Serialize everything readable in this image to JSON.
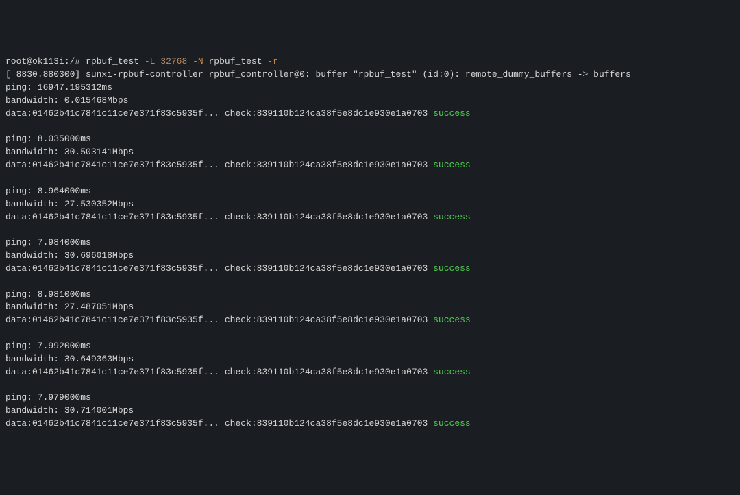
{
  "prompt_line": {
    "prompt": "root@ok113i:/# ",
    "cmd": "rpbuf_test ",
    "flag1": "-L ",
    "arg1": "32768 ",
    "flag2": "-N ",
    "arg2": "rpbuf_test ",
    "flag3": "-r"
  },
  "kernel_log": "[ 8830.880300] sunxi-rpbuf-controller rpbuf_controller@0: buffer \"rpbuf_test\" (id:0): remote_dummy_buffers -> buffers",
  "data_prefix": "data:01462b41c7841c11ce7e371f83c5935f... check:839110b124ca38f5e8dc1e930e1a0703 ",
  "success_label": "success",
  "blocks": [
    {
      "ping": "ping: 16947.195312ms",
      "bw": "bandwidth: 0.015468Mbps"
    },
    {
      "ping": "ping: 8.035000ms",
      "bw": "bandwidth: 30.503141Mbps"
    },
    {
      "ping": "ping: 8.964000ms",
      "bw": "bandwidth: 27.530352Mbps"
    },
    {
      "ping": "ping: 7.984000ms",
      "bw": "bandwidth: 30.696018Mbps"
    },
    {
      "ping": "ping: 8.981000ms",
      "bw": "bandwidth: 27.487051Mbps"
    },
    {
      "ping": "ping: 7.992000ms",
      "bw": "bandwidth: 30.649363Mbps"
    },
    {
      "ping": "ping: 7.979000ms",
      "bw": "bandwidth: 30.714001Mbps"
    }
  ]
}
